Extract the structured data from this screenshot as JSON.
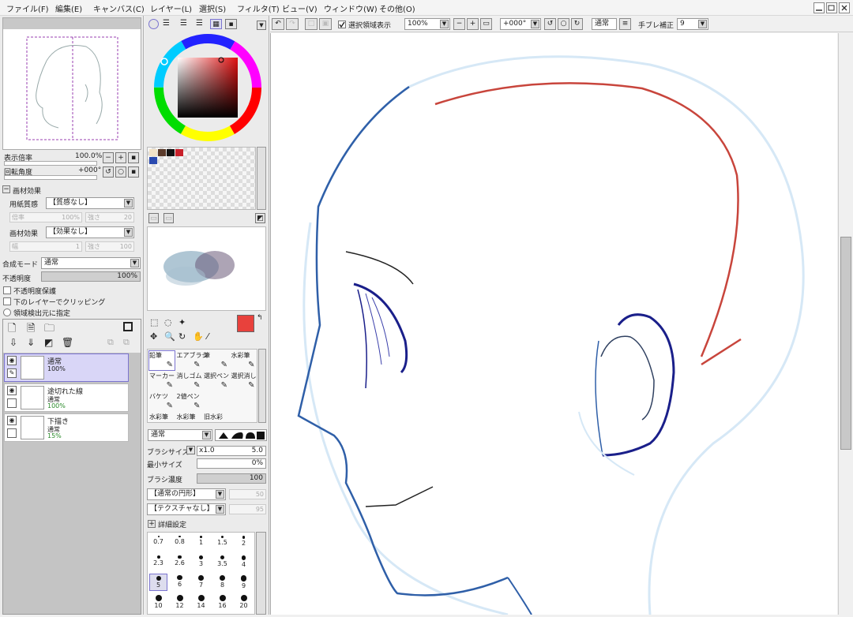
{
  "menu": [
    "ファイル(F)",
    "編集(E)",
    "キャンバス(C)",
    "レイヤー(L)",
    "選択(S)",
    "フィルタ(T)",
    "ビュー(V)",
    "ウィンドウ(W)",
    "その他(O)"
  ],
  "window_buttons": [
    "minimize",
    "restore",
    "close"
  ],
  "toolbar": {
    "select_area_checkbox": "選択領域表示",
    "zoom": "100%",
    "rotation": "+000°",
    "blend_mode": "通常",
    "stabilizer_label": "手ブレ補正",
    "stabilizer_value": "9"
  },
  "navigator": {
    "zoom_label": "表示倍率",
    "zoom_value": "100.0%",
    "rotate_label": "回転角度",
    "rotate_value": "+000°"
  },
  "effects": {
    "header": "画材効果",
    "paper_label": "用紙質感",
    "paper_value": "【質感なし】",
    "paper_scale": "100%",
    "paper_strength": "20",
    "effect_label": "画材効果",
    "effect_value": "【効果なし】",
    "effect_width": "1",
    "effect_strength": "100",
    "w_label": "倍率",
    "s_label": "強さ",
    "width_label": "幅"
  },
  "layer_props": {
    "blend_label": "合成モード",
    "blend_value": "通常",
    "opacity_label": "不透明度",
    "opacity_value": "100%",
    "opacity_fraction": 1.0,
    "protect": "不透明度保護",
    "clip": "下のレイヤーでクリッピング",
    "source": "領域検出元に指定"
  },
  "layers": [
    {
      "name": "通常",
      "mode": "100%",
      "opacity": ""
    },
    {
      "name": "途切れた線",
      "mode": "通常",
      "opacity": "100%"
    },
    {
      "name": "下描き",
      "mode": "通常",
      "opacity": "15%"
    }
  ],
  "color": {
    "primary": "#e8413c",
    "secondary": "#ffffff",
    "swatches": [
      "#f3e3c8",
      "#5a3a2a",
      "#111111",
      "#c8202a",
      "#2a4ab0"
    ]
  },
  "tools": [
    {
      "label": "鉛筆",
      "icon": "pencil-icon"
    },
    {
      "label": "エアブラシ",
      "icon": "airbrush-icon"
    },
    {
      "label": "筆",
      "icon": "brush-icon"
    },
    {
      "label": "水彩筆",
      "icon": "watercolor-icon"
    },
    {
      "label": "マーカー",
      "icon": "marker-icon"
    },
    {
      "label": "消しゴム",
      "icon": "eraser-icon"
    },
    {
      "label": "選択ペン",
      "icon": "select-pen-icon"
    },
    {
      "label": "選択消し",
      "icon": "select-erase-icon"
    },
    {
      "label": "バケツ",
      "icon": "bucket-icon"
    },
    {
      "label": "2値ペン",
      "icon": "binary-pen-icon"
    },
    {
      "label": "",
      "icon": ""
    },
    {
      "label": "",
      "icon": ""
    },
    {
      "label": "水彩筆",
      "icon": ""
    },
    {
      "label": "水彩筆",
      "icon": ""
    },
    {
      "label": "旧水彩",
      "icon": ""
    }
  ],
  "brush": {
    "mode": "通常",
    "size_label": "ブラシサイズ",
    "size_mult": "x1.0",
    "size_value": "5.0",
    "min_label": "最小サイズ",
    "min_value": "0%",
    "density_label": "ブラシ濃度",
    "density_value": "100",
    "shape": "【通常の円形】",
    "shape_val": "50",
    "texture": "【テクスチャなし】",
    "texture_val": "95",
    "detail": "詳細設定",
    "sizes": [
      "0.7",
      "0.8",
      "1",
      "1.5",
      "2",
      "2.3",
      "2.6",
      "3",
      "3.5",
      "4",
      "5",
      "6",
      "7",
      "8",
      "9",
      "10",
      "12",
      "14",
      "16",
      "20"
    ]
  }
}
